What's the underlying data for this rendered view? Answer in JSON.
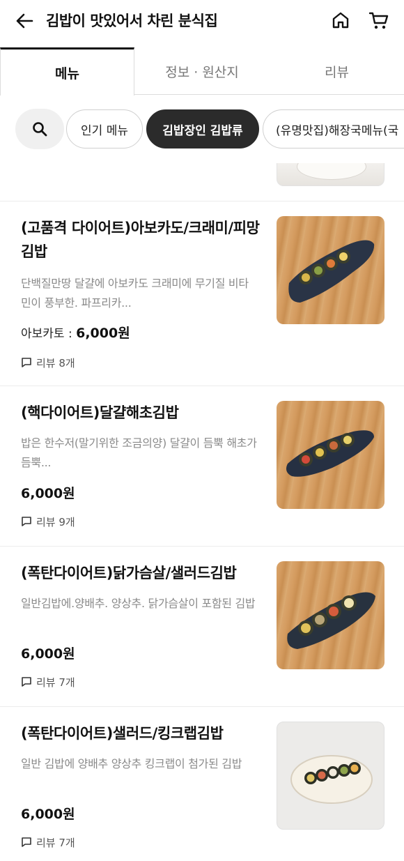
{
  "header": {
    "title": "김밥이 맛있어서 차린 분식집",
    "back_icon": "arrow-left-icon",
    "home_icon": "home-icon",
    "cart_icon": "cart-icon"
  },
  "tabs": [
    {
      "label": "메뉴",
      "active": true
    },
    {
      "label": "정보 · 원산지",
      "active": false
    },
    {
      "label": "리뷰",
      "active": false
    }
  ],
  "categories": [
    {
      "label": "인기 메뉴",
      "active": false
    },
    {
      "label": "김밥장인 김밥류",
      "active": true
    },
    {
      "label": "(유명맛집)해장국메뉴(국",
      "active": false
    }
  ],
  "menu_items": [
    {
      "name": "(고품격 다이어트)아보카도/크래미/피망김밥",
      "description": "단백질만땅 달걀에 아보카도 크래미에 무기질 비타민이 풍부한. 파프리카...",
      "price_label": "아보카토 : ",
      "price": "6,000원",
      "reviews": "리뷰 8개"
    },
    {
      "name": "(핵다이어트)달걀해초김밥",
      "description": "밥은 한수저(말기위한 조금의양) 달걀이 듬뿍 해초가듬뿍...",
      "price_label": "",
      "price": "6,000원",
      "reviews": "리뷰 9개"
    },
    {
      "name": "(폭탄다이어트)닭가슴살/샐러드김밥",
      "description": "일반김밥에.양배추. 양상추. 닭가슴살이 포함된 김밥",
      "price_label": "",
      "price": "6,000원",
      "reviews": "리뷰 7개"
    },
    {
      "name": "(폭탄다이어트)샐러드/킹크랩김밥",
      "description": "일반 김밥에 양배추 양상추 킹크랩이 첨가된 김밥",
      "price_label": "",
      "price": "6,000원",
      "reviews": "리뷰 7개"
    }
  ]
}
